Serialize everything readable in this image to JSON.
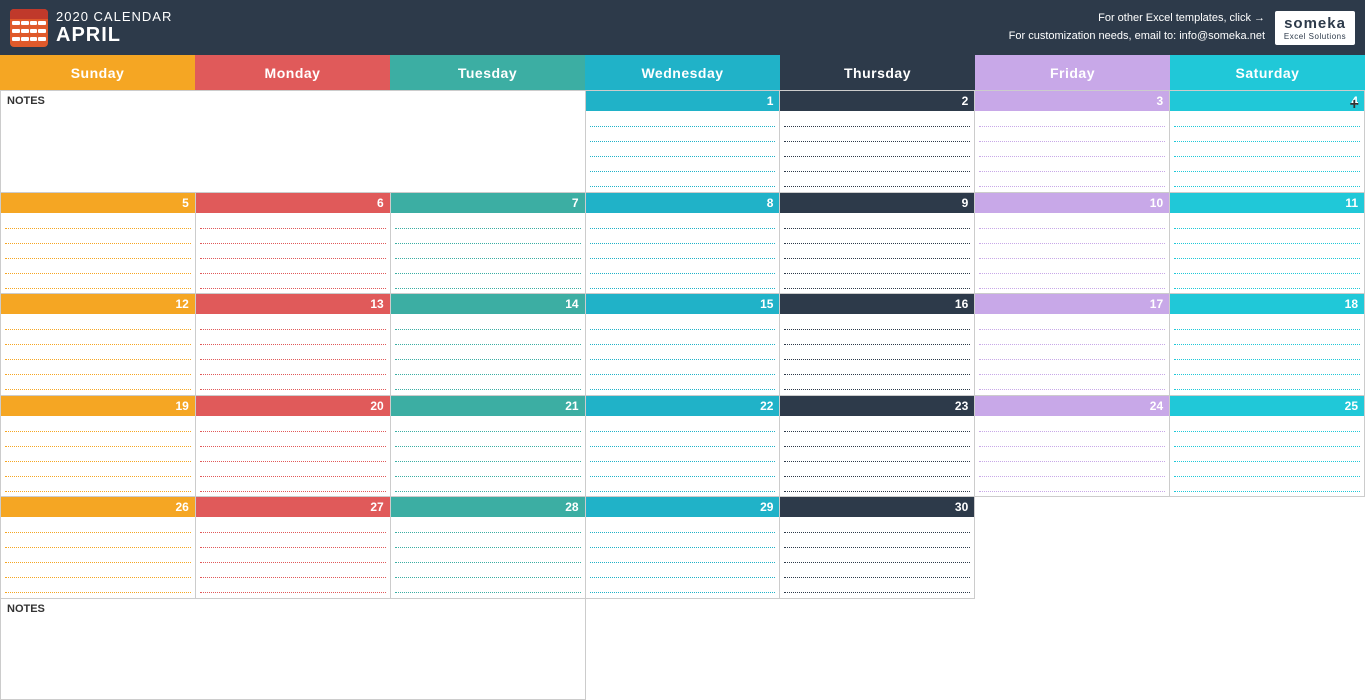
{
  "header": {
    "year_label": "2020 CALENDAR",
    "month_label": "APRIL",
    "right_text_1": "For other Excel templates, click →",
    "right_text_2": "For customization needs, email to: info@someka.net",
    "brand": "someka",
    "brand_sub": "Excel Solutions"
  },
  "days": {
    "sunday": "Sunday",
    "monday": "Monday",
    "tuesday": "Tuesday",
    "wednesday": "Wednesday",
    "thursday": "Thursday",
    "friday": "Friday",
    "saturday": "Saturday"
  },
  "notes_label": "NOTES",
  "calendar": {
    "rows": [
      [
        null,
        null,
        null,
        "1",
        "2",
        "3",
        "4"
      ],
      [
        "5",
        "6",
        "7",
        "8",
        "9",
        "10",
        "11"
      ],
      [
        "12",
        "13",
        "14",
        "15",
        "16",
        "17",
        "18"
      ],
      [
        "19",
        "20",
        "21",
        "22",
        "23",
        "24",
        "25"
      ],
      [
        "26",
        "27",
        "28",
        "29",
        "30",
        null,
        null
      ]
    ]
  }
}
